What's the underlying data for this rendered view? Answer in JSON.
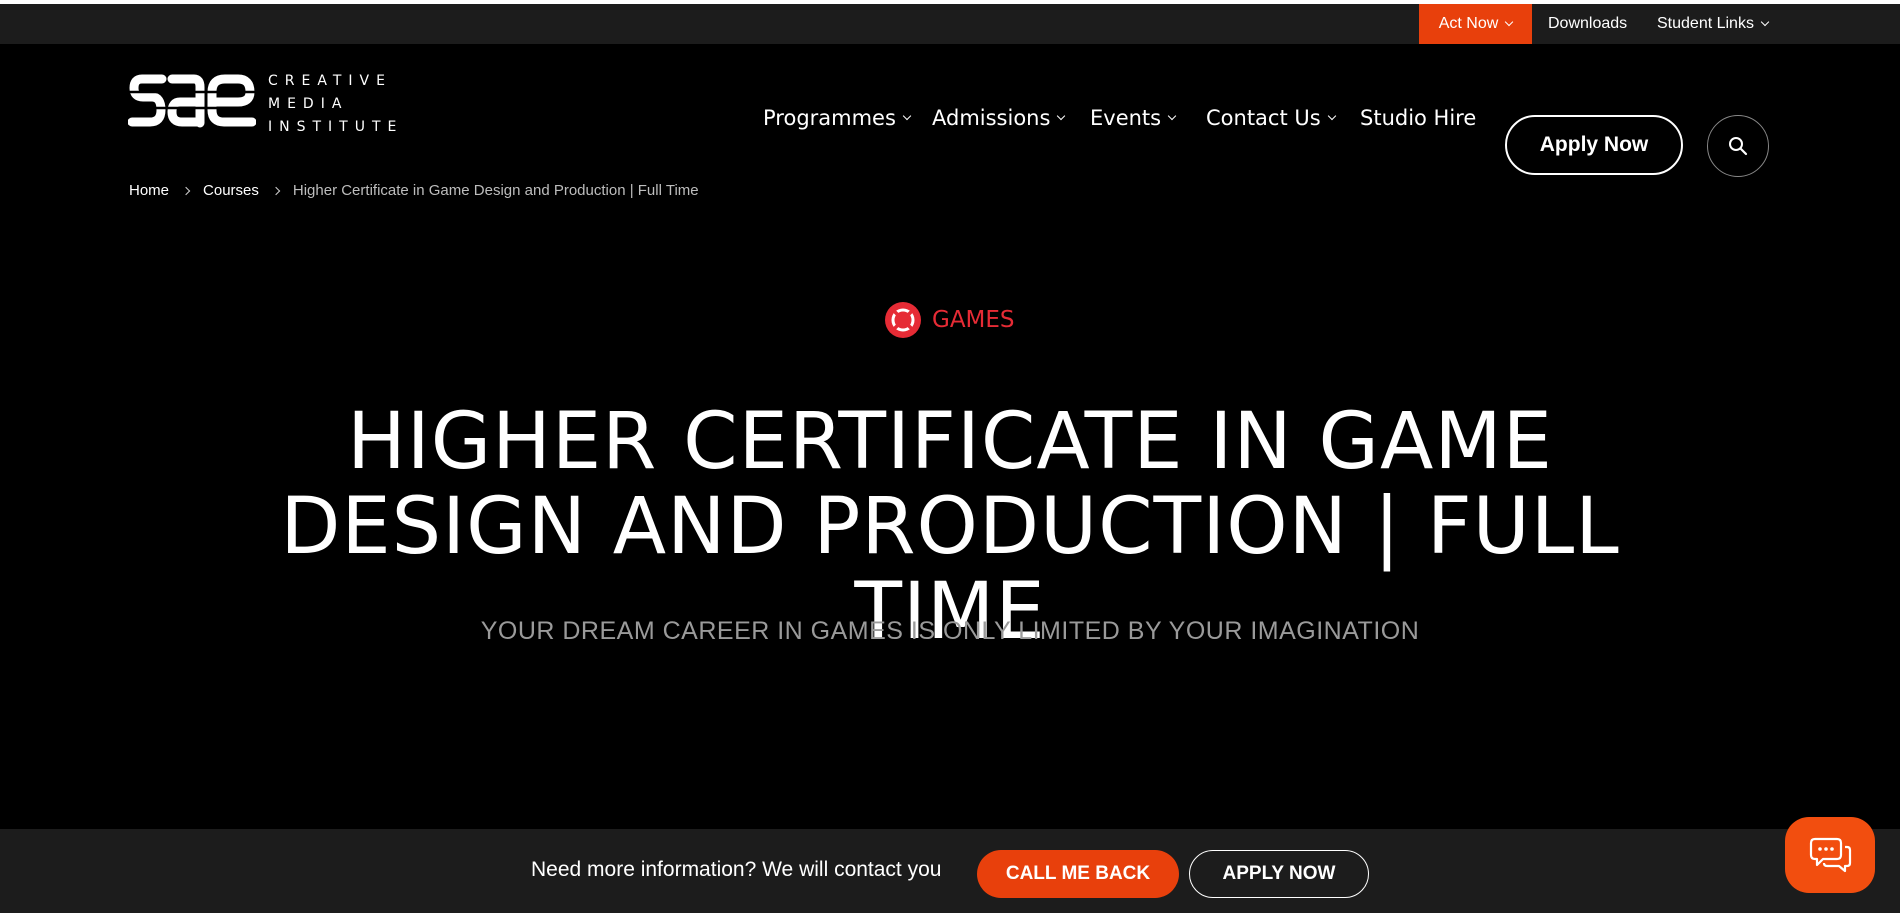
{
  "utility": {
    "act_now": "Act Now",
    "downloads": "Downloads",
    "student_links": "Student Links"
  },
  "logo": {
    "wordmark": "sae",
    "line1": "CREATIVE",
    "line2": "MEDIA",
    "line3": "INSTITUTE"
  },
  "nav": {
    "items": [
      {
        "label": "Programmes"
      },
      {
        "label": "Admissions"
      },
      {
        "label": "Events"
      },
      {
        "label": "Contact Us"
      },
      {
        "label": "Studio Hire"
      }
    ],
    "apply_label": "Apply Now",
    "search_icon": "search-icon"
  },
  "breadcrumb": {
    "home": "Home",
    "courses": "Courses",
    "current": "Higher Certificate in Game Design and Production | Full Time"
  },
  "hero": {
    "category": "GAMES",
    "title": "HIGHER CERTIFICATE IN GAME DESIGN AND PRODUCTION | FULL TIME",
    "subtitle": "YOUR DREAM CAREER IN GAMES IS ONLY LIMITED BY YOUR IMAGINATION"
  },
  "bottom_bar": {
    "text": "Need more information? We will contact you",
    "call_back": "CALL ME BACK",
    "apply": "APPLY NOW"
  },
  "colors": {
    "accent": "#e8400c",
    "category_red": "#e62b35",
    "background": "#000000",
    "bar": "#1c1c1c"
  }
}
